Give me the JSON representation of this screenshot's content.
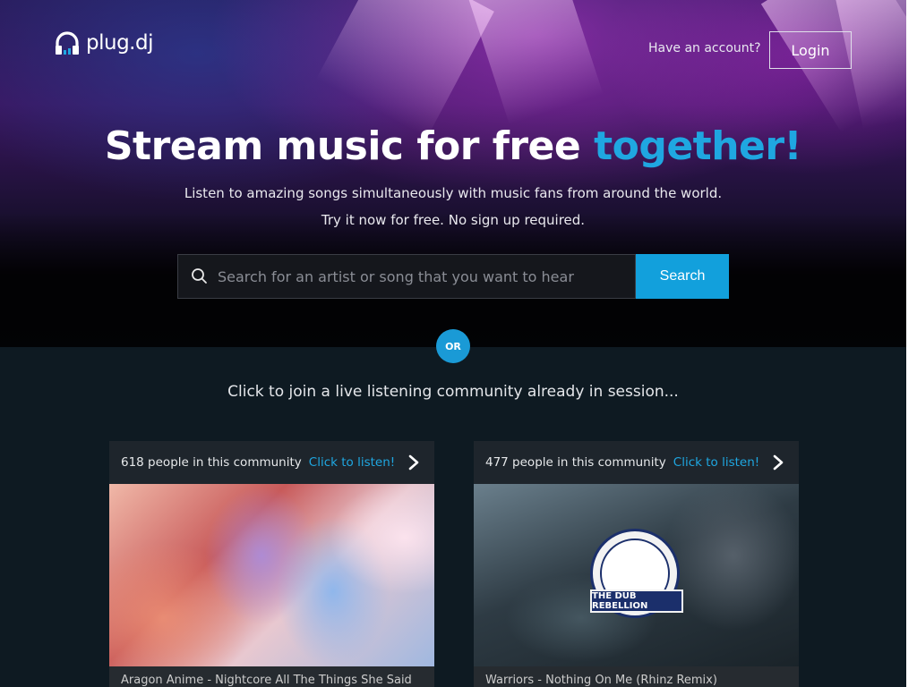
{
  "header": {
    "logo_text": "plug.dj",
    "account_prompt": "Have an account?",
    "login_label": "Login"
  },
  "hero": {
    "headline_main": "Stream music for free ",
    "headline_accent": "together!",
    "subtitle_1": "Listen to amazing songs simultaneously with music fans from around the world.",
    "subtitle_2": "Try it now for free. No sign up required."
  },
  "search": {
    "placeholder": "Search for an artist or song that you want to hear",
    "button_label": "Search"
  },
  "divider": {
    "or_label": "OR"
  },
  "communities": {
    "intro": "Click to join a live listening community already in session...",
    "cards": [
      {
        "count_text": "618 people in this community",
        "listen_label": "Click to listen!",
        "now_playing": "Aragon Anime - Nightcore All The Things She Said"
      },
      {
        "count_text": "477 people in this community",
        "listen_label": "Click to listen!",
        "now_playing": "Warriors - Nothing On Me (Rhinz Remix)"
      }
    ],
    "emblem_banner": "THE DUB REBELLION"
  },
  "colors": {
    "accent": "#1fa7e1",
    "search_button": "#12a0dc",
    "page_background": "#0e1a22"
  }
}
